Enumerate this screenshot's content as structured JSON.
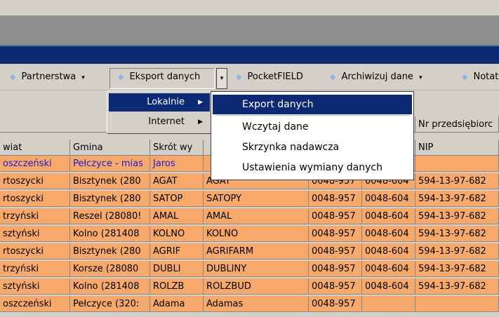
{
  "toolbar": {
    "items": [
      {
        "label": "Partnerstwa",
        "has_caret": true
      },
      {
        "label": "Eksport danych",
        "has_caret": false
      },
      {
        "label": "PocketFIELD",
        "has_caret": false
      },
      {
        "label": "Archiwizuj dane",
        "has_caret": true
      },
      {
        "label": "Notat",
        "has_caret": false
      }
    ],
    "caret": "▾",
    "dot": "◆"
  },
  "menu_export": {
    "items": [
      {
        "label": "Lokalnie",
        "arrow": "▶"
      },
      {
        "label": "Internet",
        "arrow": "▶"
      }
    ]
  },
  "menu_lokalnie": {
    "items": [
      {
        "label": "Export danych"
      },
      {
        "label": "Wczytaj dane"
      },
      {
        "label": "Skrzynka nadawcza"
      },
      {
        "label": "Ustawienia wymiany danych"
      }
    ]
  },
  "grid": {
    "group_header": "Nr przedsiębiorc",
    "headers": [
      "wiat",
      "Gmina",
      "Skrót wy",
      "",
      "",
      "",
      "NIP"
    ],
    "rows": [
      [
        "oszczeński",
        "Pełczyce - mias",
        "Jaros",
        "",
        "",
        "",
        ""
      ],
      [
        "rtoszycki",
        "Bisztynek (280",
        "AGAT",
        "AGAT",
        "0048-957",
        "0048-604",
        "594-13-97-682"
      ],
      [
        "rtoszycki",
        "Bisztynek (280",
        "SATOP",
        "SATOPY",
        "0048-957",
        "0048-604",
        "594-13-97-682"
      ],
      [
        "trzyński",
        "Reszel (28080!",
        "AMAL",
        "AMAL",
        "0048-957",
        "0048-604",
        "594-13-97-682"
      ],
      [
        "sztyński",
        "Kolno (281408",
        "KOLNO",
        "KOLNO",
        "0048-957",
        "0048-604",
        "594-13-97-682"
      ],
      [
        "rtoszycki",
        "Bisztynek (280",
        "AGRIF",
        "AGRIFARM",
        "0048-957",
        "0048-604",
        "594-13-97-682"
      ],
      [
        "trzyński",
        "Korsze (28080",
        "DUBLI",
        "DUBLINY",
        "0048-957",
        "0048-604",
        "594-13-97-682"
      ],
      [
        "sztyński",
        "Kolno (281408",
        "ROLZB",
        "ROLZBUD",
        "0048-957",
        "0048-604",
        "594-13-97-682"
      ],
      [
        "oszczeński",
        "Pełczyce (320:",
        "Adama",
        "Adamas",
        "0048-957",
        "",
        ""
      ]
    ]
  }
}
